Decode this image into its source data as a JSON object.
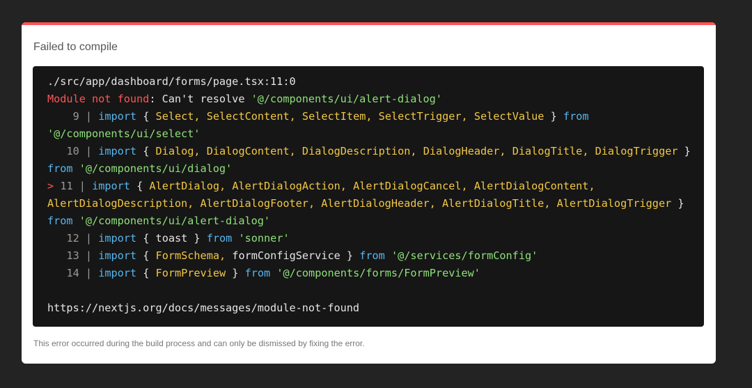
{
  "overlay": {
    "title": "Failed to compile",
    "footer": "This error occurred during the build process and can only be dismissed by fixing the error.",
    "colors": {
      "background": "#232323",
      "accent": "#ff5555",
      "keyword": "#56b6f0",
      "identifier": "#f2c744",
      "string": "#8fe07a",
      "code_bg": "#161616"
    }
  },
  "code": {
    "file_path": "./src/app/dashboard/forms/page.tsx:11:0",
    "error_label": "Module not found",
    "error_msg_prefix": ": Can't resolve ",
    "error_module": "'@/components/ui/alert-dialog'",
    "l9_num": "9",
    "l10_num": "10",
    "l11_marker": ">",
    "l11_num": "11",
    "l12_num": "12",
    "l13_num": "13",
    "l14_num": "14",
    "pipe": "|",
    "kw_import": "import",
    "kw_from": "from",
    "brace_open": "{",
    "brace_close": "}",
    "comma": ",",
    "l9_ids": [
      "Select",
      "SelectContent",
      "SelectItem",
      "SelectTrigger",
      "SelectValue"
    ],
    "l9_src": "'@/components/ui/select'",
    "l10_ids": [
      "Dialog",
      "DialogContent",
      "DialogDescription",
      "DialogHeader",
      "DialogTitle",
      "DialogTrigger"
    ],
    "l10_src": "'@/components/ui/dialog'",
    "l11_ids_a": [
      "AlertDialog",
      "AlertDialogAction",
      "AlertDialogCancel",
      "AlertDialogContent"
    ],
    "l11_ids_b": [
      "AlertDialogDescription",
      "AlertDialogFooter",
      "AlertDialogHeader",
      "AlertDialogTitle",
      "AlertDialogTrigger"
    ],
    "l11_src": "'@/components/ui/alert-dialog'",
    "l12_ident": "toast",
    "l12_src": "'sonner'",
    "l13_id": "FormSchema",
    "l13_plain": "formConfigService",
    "l13_src": "'@/services/formConfig'",
    "l14_id": "FormPreview",
    "l14_src": "'@/components/forms/FormPreview'",
    "docs_link": "https://nextjs.org/docs/messages/module-not-found"
  }
}
